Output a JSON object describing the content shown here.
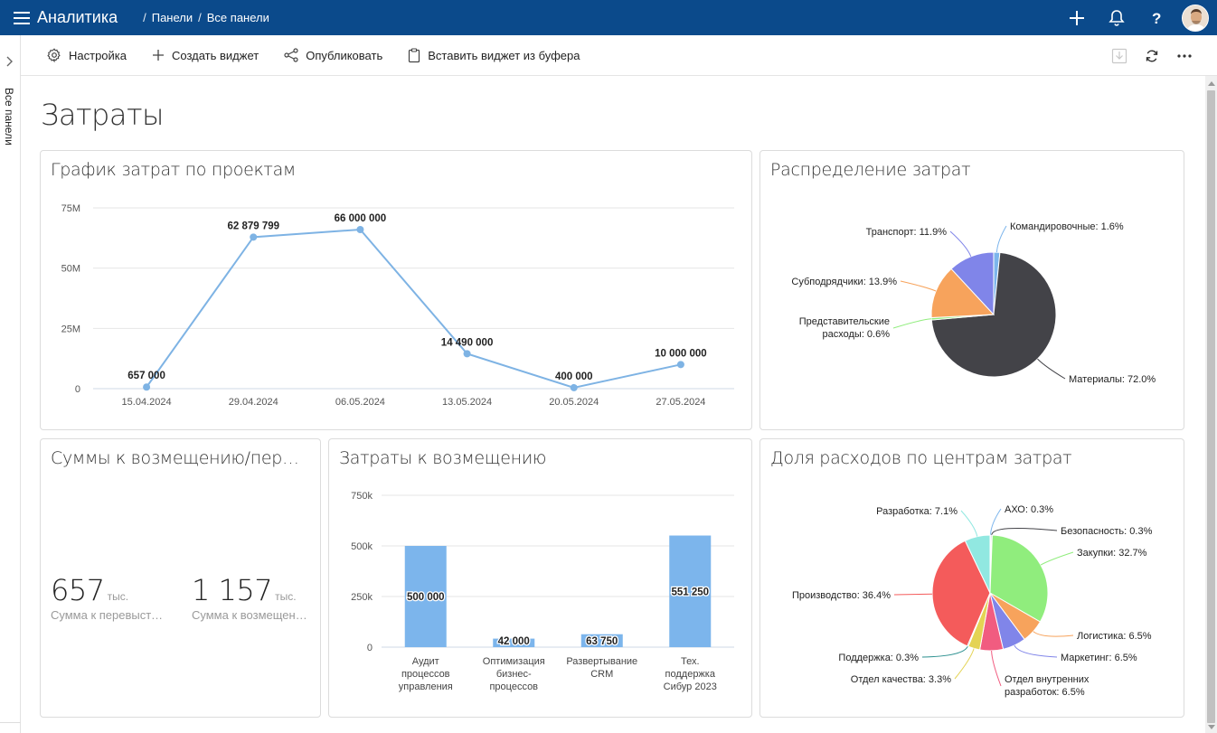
{
  "app": {
    "title": "Аналитика"
  },
  "breadcrumb": [
    "Панели",
    "Все панели"
  ],
  "rail": {
    "label": "Все панели"
  },
  "toolbar": {
    "settings": "Настройка",
    "create_widget": "Создать виджет",
    "publish": "Опубликовать",
    "paste_widget": "Вставить виджет из буфера"
  },
  "page": {
    "title": "Затраты"
  },
  "widgets": {
    "line": {
      "title": "График затрат по проектам"
    },
    "pie1": {
      "title": "Распределение затрат"
    },
    "kpi": {
      "title": "Суммы к возмещению/перевыставлению",
      "items": [
        {
          "value": "657",
          "unit": "тыс.",
          "caption": "Сумма к перевыставлению"
        },
        {
          "value": "1 157",
          "unit": "тыс.",
          "caption": "Сумма к возмещению"
        }
      ]
    },
    "bar": {
      "title": "Затраты к возмещению"
    },
    "pie2": {
      "title": "Доля расходов по центрам затрат"
    }
  },
  "chart_data": [
    {
      "type": "line",
      "title": "График затрат по проектам",
      "x": [
        "15.04.2024",
        "29.04.2024",
        "06.05.2024",
        "13.05.2024",
        "20.05.2024",
        "27.05.2024"
      ],
      "values": [
        657000,
        62879799,
        66000000,
        14490000,
        400000,
        10000000
      ],
      "data_labels": [
        "657 000",
        "62 879 799",
        "66 000 000",
        "14 490 000",
        "400 000",
        "10 000 000"
      ],
      "y_ticks": [
        0,
        25000000,
        50000000,
        75000000
      ],
      "y_tick_labels": [
        "0",
        "25M",
        "50M",
        "75M"
      ],
      "ylim": [
        0,
        75000000
      ],
      "color": "#7eb3e4",
      "grid": true
    },
    {
      "type": "pie",
      "title": "Распределение затрат",
      "slices": [
        {
          "label": "Командировочные",
          "value": 1.6,
          "text": "Командировочные: 1.6%",
          "color": "#7cb5ec"
        },
        {
          "label": "Материалы",
          "value": 72.0,
          "text": "Материалы: 72.0%",
          "color": "#434348"
        },
        {
          "label": "Представительские расходы",
          "value": 0.6,
          "text": "Представительские расходы: 0.6%",
          "color": "#90ed7d"
        },
        {
          "label": "Субподрядчики",
          "value": 13.9,
          "text": "Субподрядчики: 13.9%",
          "color": "#f7a35c"
        },
        {
          "label": "Транспорт",
          "value": 11.9,
          "text": "Транспорт: 11.9%",
          "color": "#8085e9"
        }
      ]
    },
    {
      "type": "bar",
      "title": "Затраты к возмещению",
      "categories": [
        "Аудит процессов управления",
        "Оптимизация бизнес-процессов",
        "Развертывание CRM",
        "Тех. поддержка Сибур 2023"
      ],
      "category_lines": [
        [
          "Аудит",
          "процессов",
          "управления"
        ],
        [
          "Оптимизация",
          "бизнес-",
          "процессов"
        ],
        [
          "Развертывание",
          "CRM"
        ],
        [
          "Тех.",
          "поддержка",
          "Сибур 2023"
        ]
      ],
      "values": [
        500000,
        42000,
        63750,
        551250
      ],
      "data_labels": [
        "500 000",
        "42 000",
        "63 750",
        "551 250"
      ],
      "y_ticks": [
        0,
        250000,
        500000,
        750000
      ],
      "y_tick_labels": [
        "0",
        "250k",
        "500k",
        "750k"
      ],
      "ylim": [
        0,
        750000
      ],
      "color": "#7cb5ec",
      "grid": true
    },
    {
      "type": "pie",
      "title": "Доля расходов по центрам затрат",
      "slices": [
        {
          "label": "АХО",
          "value": 0.3,
          "text": "АХО: 0.3%",
          "color": "#7cb5ec"
        },
        {
          "label": "Безопасность",
          "value": 0.3,
          "text": "Безопасность: 0.3%",
          "color": "#434348"
        },
        {
          "label": "Закупки",
          "value": 32.7,
          "text": "Закупки: 32.7%",
          "color": "#90ed7d"
        },
        {
          "label": "Логистика",
          "value": 6.5,
          "text": "Логистика: 6.5%",
          "color": "#f7a35c"
        },
        {
          "label": "Маркетинг",
          "value": 6.5,
          "text": "Маркетинг: 6.5%",
          "color": "#8085e9"
        },
        {
          "label": "Отдел внутренних разработок",
          "value": 6.5,
          "text": "Отдел внутренних разработок: 6.5%",
          "color": "#f15c80"
        },
        {
          "label": "Отдел качества",
          "value": 3.3,
          "text": "Отдел качества: 3.3%",
          "color": "#e4d354"
        },
        {
          "label": "Поддержка",
          "value": 0.3,
          "text": "Поддержка: 0.3%",
          "color": "#2b908f"
        },
        {
          "label": "Производство",
          "value": 36.4,
          "text": "Производство: 36.4%",
          "color": "#f45b5b"
        },
        {
          "label": "Разработка",
          "value": 7.1,
          "text": "Разработка: 7.1%",
          "color": "#91e8e1"
        }
      ]
    }
  ]
}
